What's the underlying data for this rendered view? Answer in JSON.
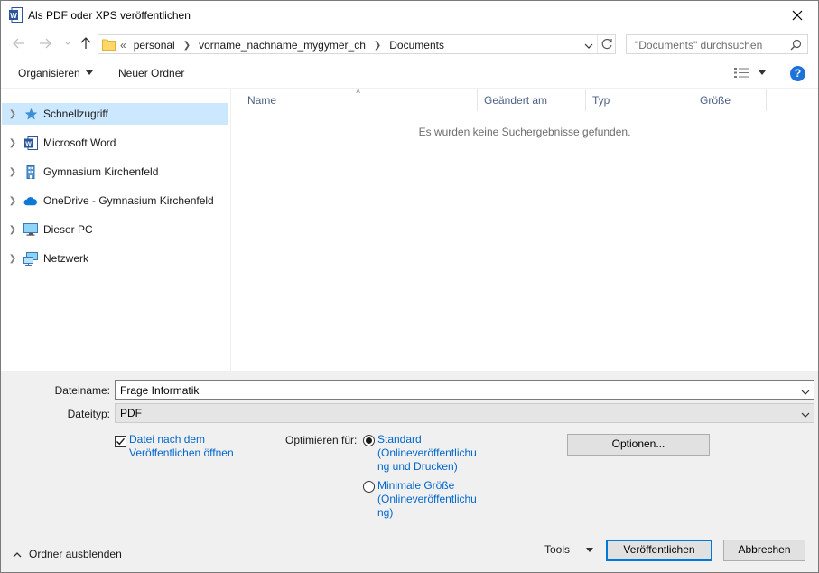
{
  "window": {
    "title": "Als PDF oder XPS veröffentlichen"
  },
  "address": {
    "crumbs": [
      "personal",
      "vorname_nachname_mygymer_ch",
      "Documents"
    ],
    "overflow_marker": "«"
  },
  "search": {
    "placeholder": "\"Documents\" durchsuchen"
  },
  "toolbar": {
    "organize_label": "Organisieren",
    "new_folder_label": "Neuer Ordner"
  },
  "nav": {
    "items": [
      {
        "label": "Schnellzugriff",
        "icon": "star-icon",
        "selected": true
      },
      {
        "label": "Microsoft Word",
        "icon": "word-icon",
        "selected": false
      },
      {
        "label": "Gymnasium Kirchenfeld",
        "icon": "building-icon",
        "selected": false
      },
      {
        "label": "OneDrive - Gymnasium Kirchenfeld",
        "icon": "cloud-icon",
        "selected": false
      },
      {
        "label": "Dieser PC",
        "icon": "computer-icon",
        "selected": false
      },
      {
        "label": "Netzwerk",
        "icon": "network-icon",
        "selected": false
      }
    ]
  },
  "filelist": {
    "columns": [
      "Name",
      "Geändert am",
      "Typ",
      "Größe"
    ],
    "empty_message": "Es wurden keine Suchergebnisse gefunden."
  },
  "form": {
    "filename_label": "Dateiname:",
    "filename_value": "Frage Informatik",
    "filetype_label": "Dateityp:",
    "filetype_value": "PDF",
    "open_after_line1": "Datei nach dem",
    "open_after_line2": "Veröffentlichen öffnen",
    "optimize_label": "Optimieren für:",
    "opt_standard_1": "Standard",
    "opt_standard_2": "(Onlineveröffentlichu",
    "opt_standard_3": "ng und Drucken)",
    "opt_min_1": "Minimale Größe",
    "opt_min_2": "(Onlineveröffentlichu",
    "opt_min_3": "ng)",
    "options_button": "Optionen..."
  },
  "footer": {
    "hide_folders": "Ordner ausblenden",
    "tools": "Tools",
    "publish": "Veröffentlichen",
    "cancel": "Abbrechen"
  },
  "colors": {
    "accent": "#0078d7",
    "selection": "#cce8ff",
    "link": "#0066cc",
    "panel": "#f0f0f0"
  }
}
